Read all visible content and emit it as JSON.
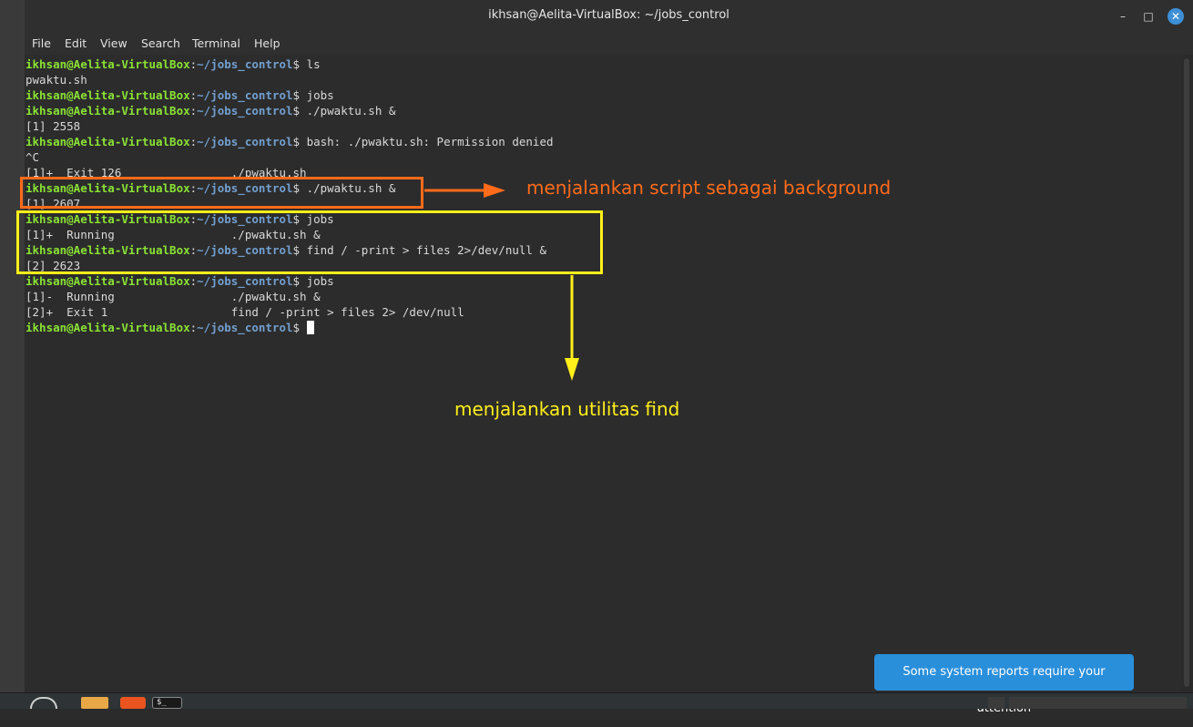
{
  "window": {
    "title": "ikhsan@Aelita-VirtualBox: ~/jobs_control"
  },
  "window_buttons": {
    "minimize": "–",
    "maximize": "□",
    "close": "✕"
  },
  "menu": [
    "File",
    "Edit",
    "View",
    "Search",
    "Terminal",
    "Help"
  ],
  "prompt": {
    "user": "ikhsan@Aelita-VirtualBox",
    "colon": ":",
    "path": "~/jobs_control",
    "dollar": "$"
  },
  "terminal_lines": [
    {
      "type": "prompt",
      "cmd": " ls"
    },
    {
      "type": "output",
      "text": "pwaktu.sh"
    },
    {
      "type": "prompt",
      "cmd": " jobs"
    },
    {
      "type": "prompt",
      "cmd": " ./pwaktu.sh &"
    },
    {
      "type": "output",
      "text": "[1] 2558"
    },
    {
      "type": "prompt",
      "cmd": " bash: ./pwaktu.sh: Permission denied"
    },
    {
      "type": "output",
      "text": "^C"
    },
    {
      "type": "output",
      "text": "[1]+  Exit 126                ./pwaktu.sh"
    },
    {
      "type": "prompt",
      "cmd": " ./pwaktu.sh &"
    },
    {
      "type": "output",
      "text": "[1] 2607"
    },
    {
      "type": "prompt",
      "cmd": " jobs"
    },
    {
      "type": "output",
      "text": "[1]+  Running                 ./pwaktu.sh &"
    },
    {
      "type": "prompt",
      "cmd": " find / -print > files 2>/dev/null &"
    },
    {
      "type": "output",
      "text": "[2] 2623"
    },
    {
      "type": "prompt",
      "cmd": " jobs"
    },
    {
      "type": "output",
      "text": "[1]-  Running                 ./pwaktu.sh &"
    },
    {
      "type": "output",
      "text": "[2]+  Exit 1                  find / -print > files 2> /dev/null"
    },
    {
      "type": "prompt",
      "cmd": " ",
      "cursor": true
    }
  ],
  "annotations": {
    "orange": "menjalankan script sebagai background",
    "yellow": "menjalankan utilitas find"
  },
  "colors": {
    "prompt_user": "#8ae234",
    "prompt_path": "#729fcf",
    "annotation_orange": "#ff6b1a",
    "annotation_yellow": "#ffef1a",
    "toast_bg": "#2a8fdb"
  },
  "toast": {
    "text": "Some system reports require your attention"
  },
  "taskbar": {
    "icons": [
      "menu-icon",
      "files-icon",
      "update-manager-icon",
      "terminal-icon"
    ],
    "terminal_glyph": "$_"
  }
}
